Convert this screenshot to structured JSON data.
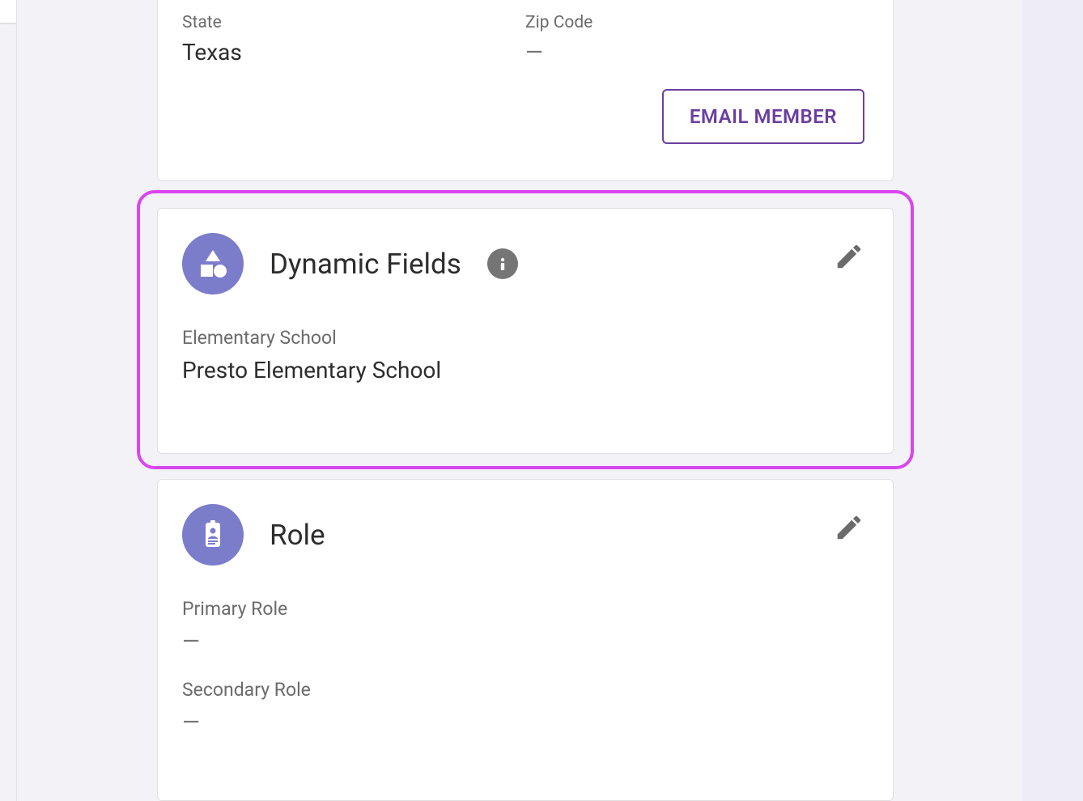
{
  "address_card": {
    "state_label": "State",
    "state_value": "Texas",
    "zip_label": "Zip Code",
    "zip_value": "—",
    "email_button": "EMAIL MEMBER"
  },
  "dynamic_fields_card": {
    "title": "Dynamic Fields",
    "field1_label": "Elementary School",
    "field1_value": "Presto Elementary School"
  },
  "role_card": {
    "title": "Role",
    "primary_label": "Primary Role",
    "primary_value": "—",
    "secondary_label": "Secondary Role",
    "secondary_value": "—"
  }
}
